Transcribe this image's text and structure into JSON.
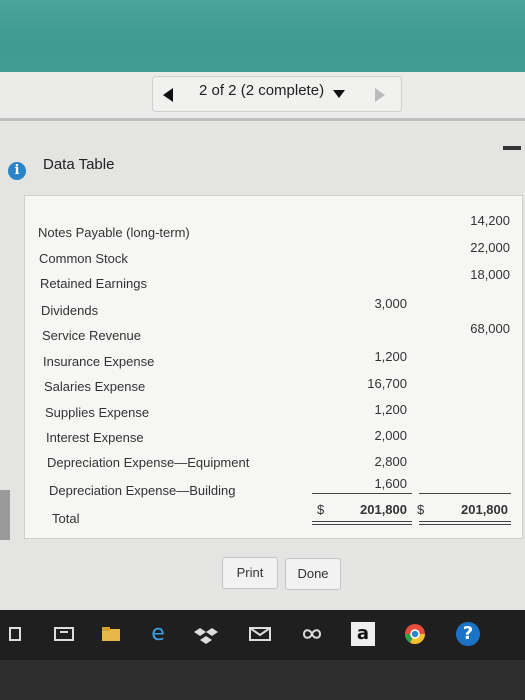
{
  "pager": {
    "label": "2 of 2 (2 complete)"
  },
  "header": {
    "title": "Data Table"
  },
  "table": {
    "rows": [
      {
        "label": "Notes Payable (long-term)",
        "debit": "",
        "credit": "14,200"
      },
      {
        "label": "Common Stock",
        "debit": "",
        "credit": "22,000"
      },
      {
        "label": "Retained Earnings",
        "debit": "",
        "credit": "18,000"
      },
      {
        "label": "Dividends",
        "debit": "3,000",
        "credit": ""
      },
      {
        "label": "Service Revenue",
        "debit": "",
        "credit": "68,000"
      },
      {
        "label": "Insurance Expense",
        "debit": "1,200",
        "credit": ""
      },
      {
        "label": "Salaries Expense",
        "debit": "16,700",
        "credit": ""
      },
      {
        "label": "Supplies Expense",
        "debit": "1,200",
        "credit": ""
      },
      {
        "label": "Interest Expense",
        "debit": "2,000",
        "credit": ""
      },
      {
        "label": "Depreciation Expense—Equipment",
        "debit": "2,800",
        "credit": ""
      },
      {
        "label": "Depreciation Expense—Building",
        "debit": "1,600",
        "credit": ""
      }
    ],
    "total": {
      "label": "Total",
      "debit_symbol": "$",
      "debit": "201,800",
      "credit_symbol": "$",
      "credit": "201,800"
    }
  },
  "buttons": {
    "print": "Print",
    "done": "Done"
  },
  "taskbar": {
    "items": [
      {
        "icon": "task-view-icon"
      },
      {
        "icon": "file-explorer-icon"
      },
      {
        "icon": "edge-icon",
        "glyph": "e"
      },
      {
        "icon": "dropbox-icon"
      },
      {
        "icon": "mail-icon"
      },
      {
        "icon": "infinity-icon"
      },
      {
        "icon": "amazon-icon",
        "glyph": "a"
      },
      {
        "icon": "chrome-icon"
      },
      {
        "icon": "help-icon",
        "glyph": "?"
      }
    ]
  },
  "colors": {
    "accent": "#419d95",
    "info": "#2a85c8"
  }
}
